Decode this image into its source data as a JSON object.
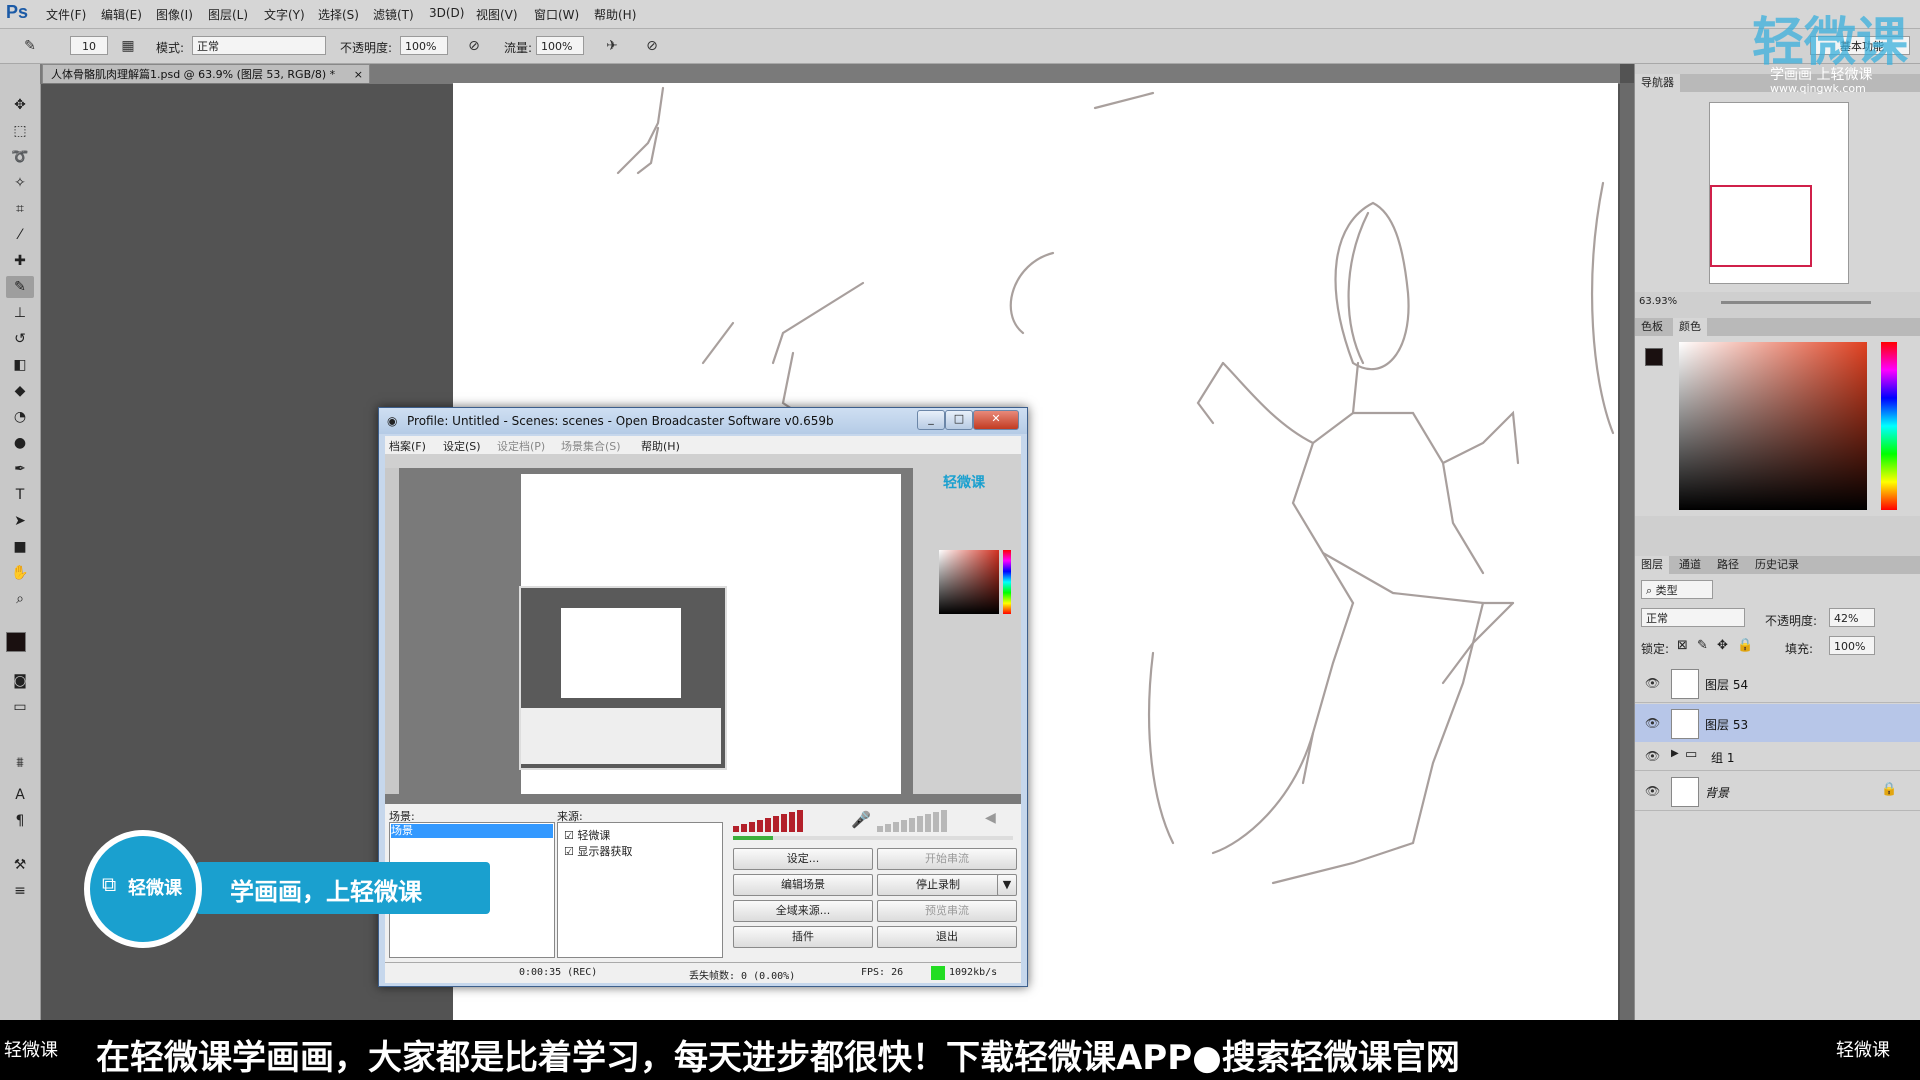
{
  "menubar": {
    "items": [
      "文件(F)",
      "编辑(E)",
      "图像(I)",
      "图层(L)",
      "文字(Y)",
      "选择(S)",
      "滤镜(T)",
      "3D(D)",
      "视图(V)",
      "窗口(W)",
      "帮助(H)"
    ],
    "workspace": "基本功能"
  },
  "options": {
    "brush_size": "10",
    "mode_label": "模式:",
    "mode_value": "正常",
    "opacity_label": "不透明度:",
    "opacity_value": "100%",
    "flow_label": "流量:",
    "flow_value": "100%"
  },
  "document": {
    "tab_title": "人体骨骼肌肉理解篇1.psd @ 63.9% (图层 53, RGB/8) *"
  },
  "navigator": {
    "tab": "导航器",
    "zoom": "63.93%"
  },
  "color_panel": {
    "tabs": [
      "色板",
      "颜色"
    ],
    "foreground": "#1a1010",
    "background": "#ffffff"
  },
  "layers_panel": {
    "tabs": [
      "图层",
      "通道",
      "路径",
      "历史记录"
    ],
    "filter_kind": "类型",
    "blend_mode": "正常",
    "opacity_label": "不透明度:",
    "opacity_value": "42%",
    "lock_label": "锁定:",
    "fill_label": "填充:",
    "fill_value": "100%",
    "layers": [
      {
        "name": "图层 54",
        "selected": false
      },
      {
        "name": "图层 53",
        "selected": true
      },
      {
        "name": "组 1",
        "selected": false
      },
      {
        "name": "背景",
        "selected": false
      }
    ]
  },
  "obs": {
    "title": "Profile: Untitled - Scenes: scenes - Open Broadcaster Software v0.659b",
    "menu": [
      "档案(F)",
      "设定(S)",
      "设定档(P)",
      "场景集合(S)",
      "帮助(H)"
    ],
    "scenes_label": "场景:",
    "scenes": [
      "场景"
    ],
    "sources_label": "来源:",
    "sources": [
      "轻微课",
      "显示器获取"
    ],
    "buttons": {
      "settings": "设定...",
      "start_stream": "开始串流",
      "edit_scene": "编辑场景",
      "stop_record": "停止录制",
      "global_sources": "全域来源...",
      "preview_stream": "预览串流",
      "plugins": "插件",
      "exit": "退出"
    },
    "status": {
      "time": "0:00:35 (REC)",
      "dropped": "丢失帧数: 0 (0.00%)",
      "fps": "FPS: 26",
      "bitrate": "1092kb/s"
    }
  },
  "watermark": {
    "logo": "轻微课",
    "slogan": "学画画 上轻微课",
    "url": "www.qingwk.com"
  },
  "badge": {
    "logo": "轻微课",
    "text": "学画画，上轻微课"
  },
  "ticker": {
    "left_logo": "轻微课",
    "text": "在轻微课学画画，大家都是比着学习，每天进步都很快！下载轻微课APP●搜索轻微课官网",
    "right_logo": "轻微课"
  }
}
